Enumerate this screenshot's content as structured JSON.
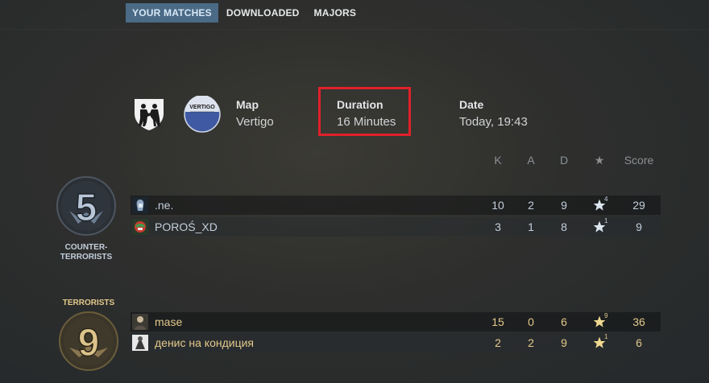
{
  "tabs": [
    {
      "label": "YOUR MATCHES",
      "active": true
    },
    {
      "label": "DOWNLOADED",
      "active": false
    },
    {
      "label": "MAJORS",
      "active": false
    }
  ],
  "match": {
    "map_label": "Map",
    "map_value": "Vertigo",
    "map_badge_text": "VERTIGO",
    "duration_label": "Duration",
    "duration_value": "16 Minutes",
    "date_label": "Date",
    "date_value": "Today, 19:43"
  },
  "columns": {
    "k": "K",
    "a": "A",
    "d": "D",
    "mvp": "★",
    "score": "Score"
  },
  "teams": {
    "ct": {
      "score": "5",
      "name_line1": "COUNTER-",
      "name_line2": "TERRORISTS",
      "color": "#c3cfdc",
      "players": [
        {
          "name": ".ne.",
          "k": "10",
          "a": "2",
          "d": "9",
          "mvp": "4",
          "score": "29"
        },
        {
          "name": "POROŚ_XD",
          "k": "3",
          "a": "1",
          "d": "8",
          "mvp": "1",
          "score": "9"
        }
      ]
    },
    "t": {
      "score": "9",
      "name": "TERRORISTS",
      "color": "#e3c98c",
      "players": [
        {
          "name": "mase",
          "k": "15",
          "a": "0",
          "d": "6",
          "mvp": "9",
          "score": "36"
        },
        {
          "name": "денис на кондиция",
          "k": "2",
          "a": "2",
          "d": "9",
          "mvp": "1",
          "score": "6"
        }
      ]
    }
  },
  "colors": {
    "highlight": "#e0202a",
    "tab_active_bg": "#4a6a86",
    "ct_accent": "#c3cfdc",
    "t_accent": "#e3c98c"
  }
}
